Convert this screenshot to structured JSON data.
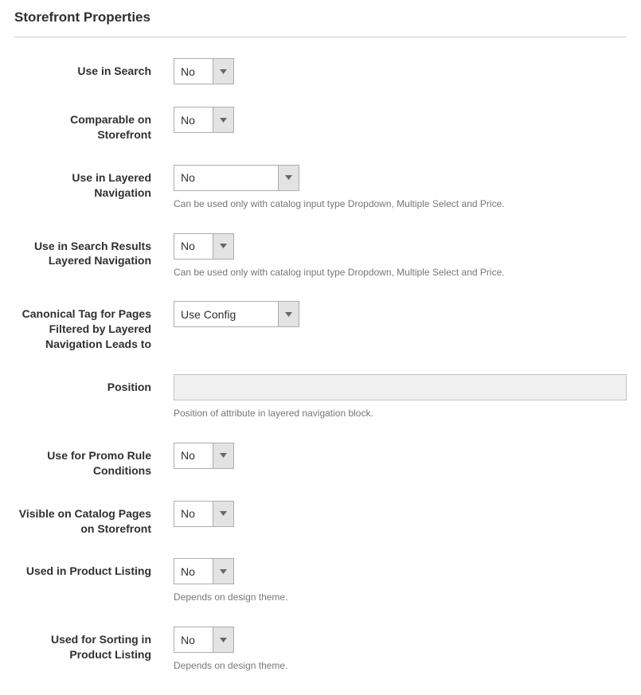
{
  "section_title": "Storefront Properties",
  "fields": {
    "use_in_search": {
      "label": "Use in Search",
      "value": "No"
    },
    "comparable": {
      "label": "Comparable on Storefront",
      "value": "No"
    },
    "layered_nav": {
      "label": "Use in Layered Navigation",
      "value": "No",
      "help": "Can be used only with catalog input type Dropdown, Multiple Select and Price."
    },
    "search_results_layered": {
      "label": "Use in Search Results Layered Navigation",
      "value": "No",
      "help": "Can be used only with catalog input type Dropdown, Multiple Select and Price."
    },
    "canonical_tag": {
      "label": "Canonical Tag for Pages Filtered by Layered Navigation Leads to",
      "value": "Use Config"
    },
    "position": {
      "label": "Position",
      "value": "",
      "help": "Position of attribute in layered navigation block."
    },
    "promo_rule": {
      "label": "Use for Promo Rule Conditions",
      "value": "No"
    },
    "visible_catalog": {
      "label": "Visible on Catalog Pages on Storefront",
      "value": "No"
    },
    "product_listing": {
      "label": "Used in Product Listing",
      "value": "No",
      "help": "Depends on design theme."
    },
    "sorting_listing": {
      "label": "Used for Sorting in Product Listing",
      "value": "No",
      "help": "Depends on design theme."
    }
  }
}
